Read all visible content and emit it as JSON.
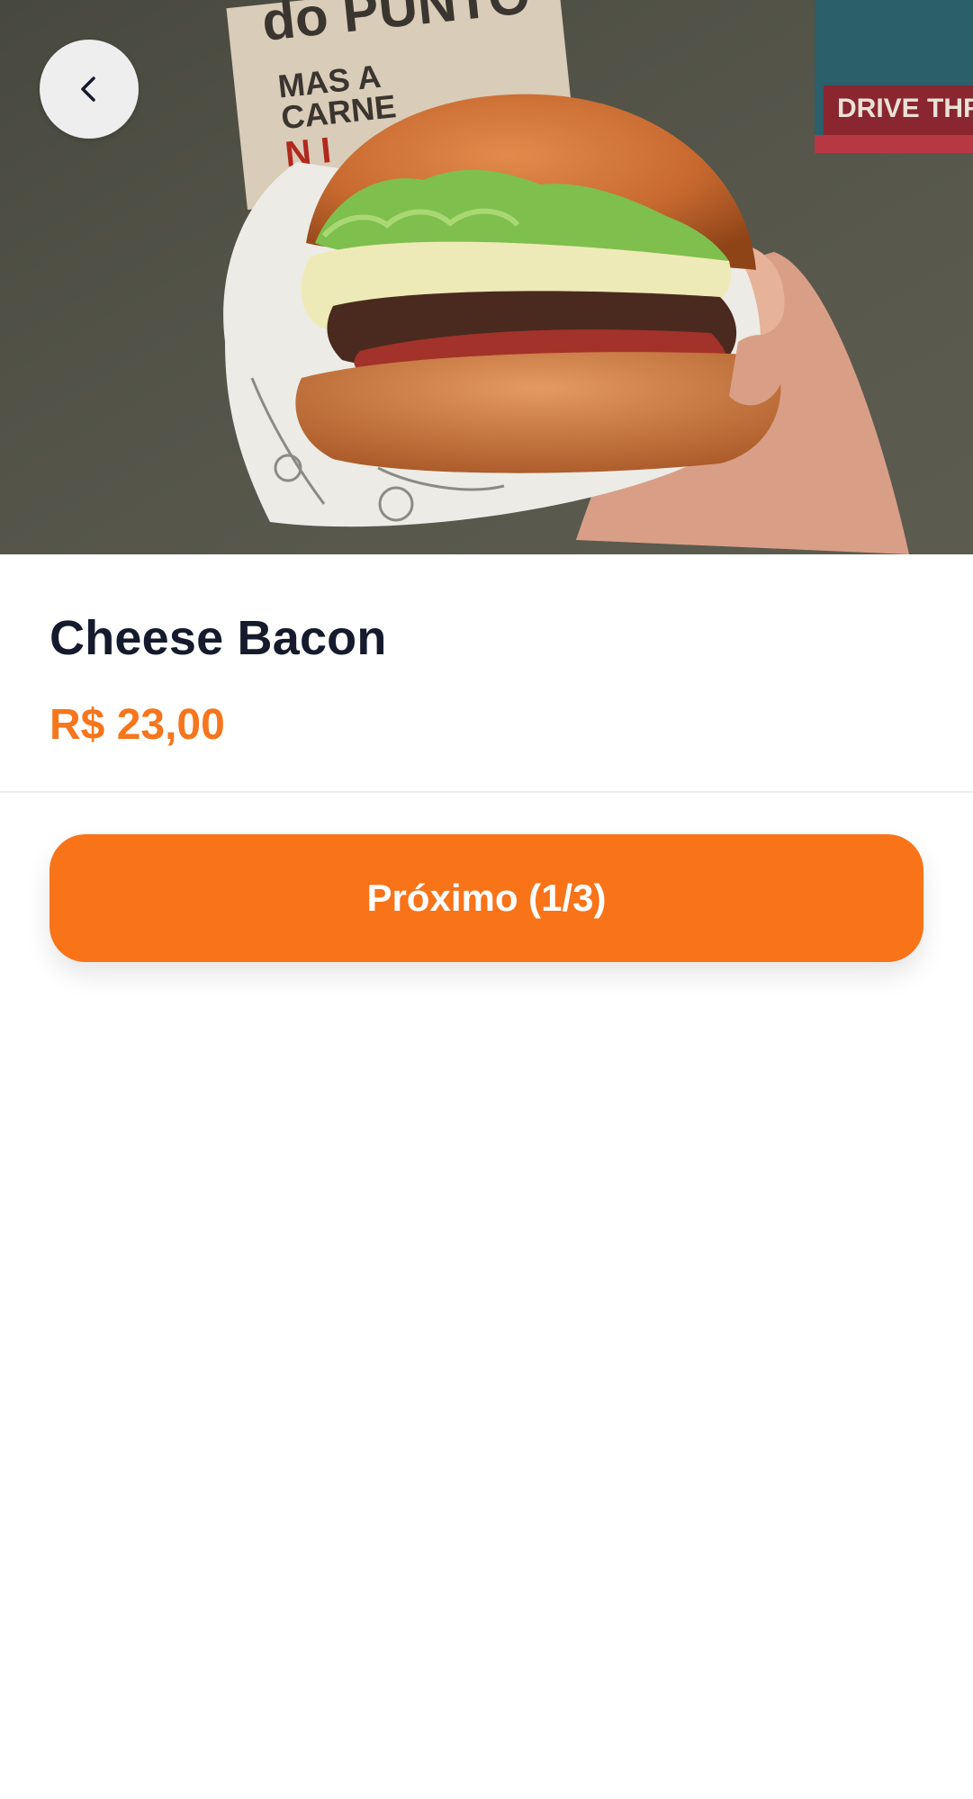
{
  "navigation": {
    "back_icon": "chevron-left-icon"
  },
  "product": {
    "name": "Cheese Bacon",
    "price": "R$ 23,00"
  },
  "actions": {
    "next_label": "Próximo (1/3)"
  },
  "colors": {
    "accent": "#f97319",
    "price": "#f7751c",
    "title": "#151b2d",
    "back_button_bg": "#efeeee"
  }
}
